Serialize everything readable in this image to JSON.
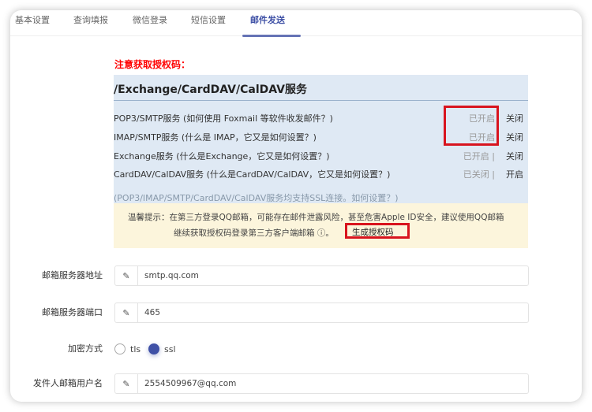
{
  "tabs": [
    {
      "label": "基本设置"
    },
    {
      "label": "查询填报"
    },
    {
      "label": "微信登录"
    },
    {
      "label": "短信设置"
    },
    {
      "label": "邮件发送",
      "active": true
    }
  ],
  "notice": "注意获取授权码：",
  "screenshot": {
    "title": "/Exchange/CardDAV/CalDAV服务",
    "services": [
      {
        "name": "POP3/SMTP服务 (如何使用 Foxmail 等软件收发邮件？)",
        "status": "已开启",
        "action": "关闭"
      },
      {
        "name": "IMAP/SMTP服务 (什么是 IMAP，它又是如何设置？)",
        "status": "已开启",
        "action": "关闭"
      },
      {
        "name": "Exchange服务 (什么是Exchange，它又是如何设置？)",
        "status": "已开启 |",
        "action": "关闭"
      },
      {
        "name": "CardDAV/CalDAV服务 (什么是CardDAV/CalDAV，它又是如何设置？)",
        "status": "已关闭 |",
        "action": "开启"
      }
    ],
    "ssl_hint": "(POP3/IMAP/SMTP/CardDAV/CalDAV服务均支持SSL连接。如何设置？)",
    "tip_line1": "温馨提示：在第三方登录QQ邮箱，可能存在邮件泄露风险，甚至危害Apple ID安全，建议使用QQ邮箱",
    "tip_line2": "继续获取授权码登录第三方客户端邮箱 ⓘ。",
    "generate_label": "生成授权码"
  },
  "form": {
    "server_label": "邮箱服务器地址",
    "server_value": "smtp.qq.com",
    "port_label": "邮箱服务器端口",
    "port_value": "465",
    "encryption_label": "加密方式",
    "encryption_options": [
      "tls",
      "ssl"
    ],
    "encryption_selected": "ssl",
    "username_label": "发件人邮箱用户名",
    "username_value": "2554509967@qq.com"
  },
  "colors": {
    "accent": "#3f51a6",
    "notice": "#ff0000",
    "highlight": "#d8141e"
  }
}
